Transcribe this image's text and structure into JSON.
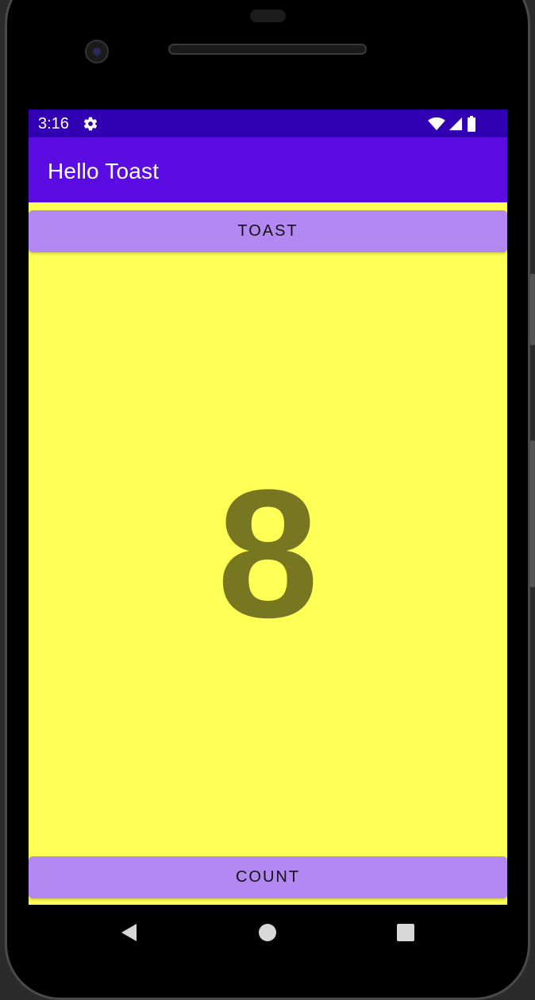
{
  "status_bar": {
    "time": "3:16",
    "settings_icon": "gear-icon",
    "wifi_icon": "wifi-icon",
    "signal_icon": "cell-signal-icon",
    "battery_icon": "battery-icon"
  },
  "app_bar": {
    "title": "Hello Toast"
  },
  "main": {
    "toast_button_label": "TOAST",
    "count_value": "8",
    "count_button_label": "COUNT"
  },
  "nav_bar": {
    "back_icon": "back-triangle-icon",
    "home_icon": "home-circle-icon",
    "recents_icon": "recents-square-icon"
  },
  "colors": {
    "status_bar": "#3200b3",
    "app_bar": "#5a0ce3",
    "background": "#ffff55",
    "button": "#b388f2",
    "count_text": "#777722"
  }
}
